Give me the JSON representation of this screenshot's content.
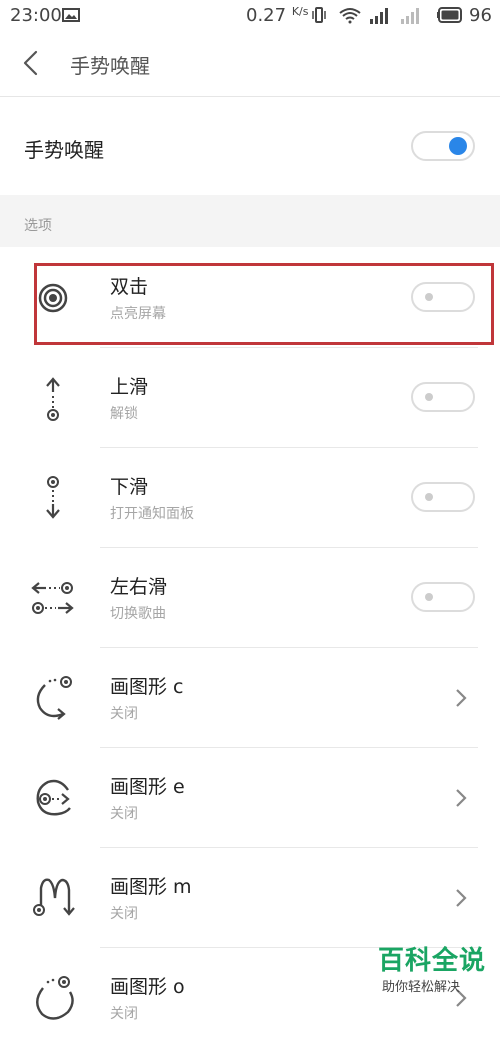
{
  "status_bar": {
    "time": "23:00",
    "net_speed": "0.27",
    "net_unit": "K/s",
    "battery": "96"
  },
  "header": {
    "title": "手势唤醒"
  },
  "master": {
    "label": "手势唤醒",
    "enabled": true
  },
  "section": {
    "label": "选项"
  },
  "gestures": [
    {
      "title": "双击",
      "subtitle": "点亮屏幕",
      "control": "switch",
      "icon": "double-tap-icon"
    },
    {
      "title": "上滑",
      "subtitle": "解锁",
      "control": "switch",
      "icon": "swipe-up-icon"
    },
    {
      "title": "下滑",
      "subtitle": "打开通知面板",
      "control": "switch",
      "icon": "swipe-down-icon"
    },
    {
      "title": "左右滑",
      "subtitle": "切换歌曲",
      "control": "switch",
      "icon": "swipe-left-right-icon"
    },
    {
      "title": "画图形 c",
      "subtitle": "关闭",
      "control": "chevron",
      "icon": "draw-c-icon"
    },
    {
      "title": "画图形 e",
      "subtitle": "关闭",
      "control": "chevron",
      "icon": "draw-e-icon"
    },
    {
      "title": "画图形 m",
      "subtitle": "关闭",
      "control": "chevron",
      "icon": "draw-m-icon"
    },
    {
      "title": "画图形 o",
      "subtitle": "关闭",
      "control": "chevron",
      "icon": "draw-o-icon"
    }
  ],
  "colors": {
    "accent": "#2a86e8",
    "highlight": "#c0363a",
    "watermark": "#1aa563"
  },
  "watermark": {
    "title": "百科全说",
    "subtitle": "助你轻松解决"
  }
}
